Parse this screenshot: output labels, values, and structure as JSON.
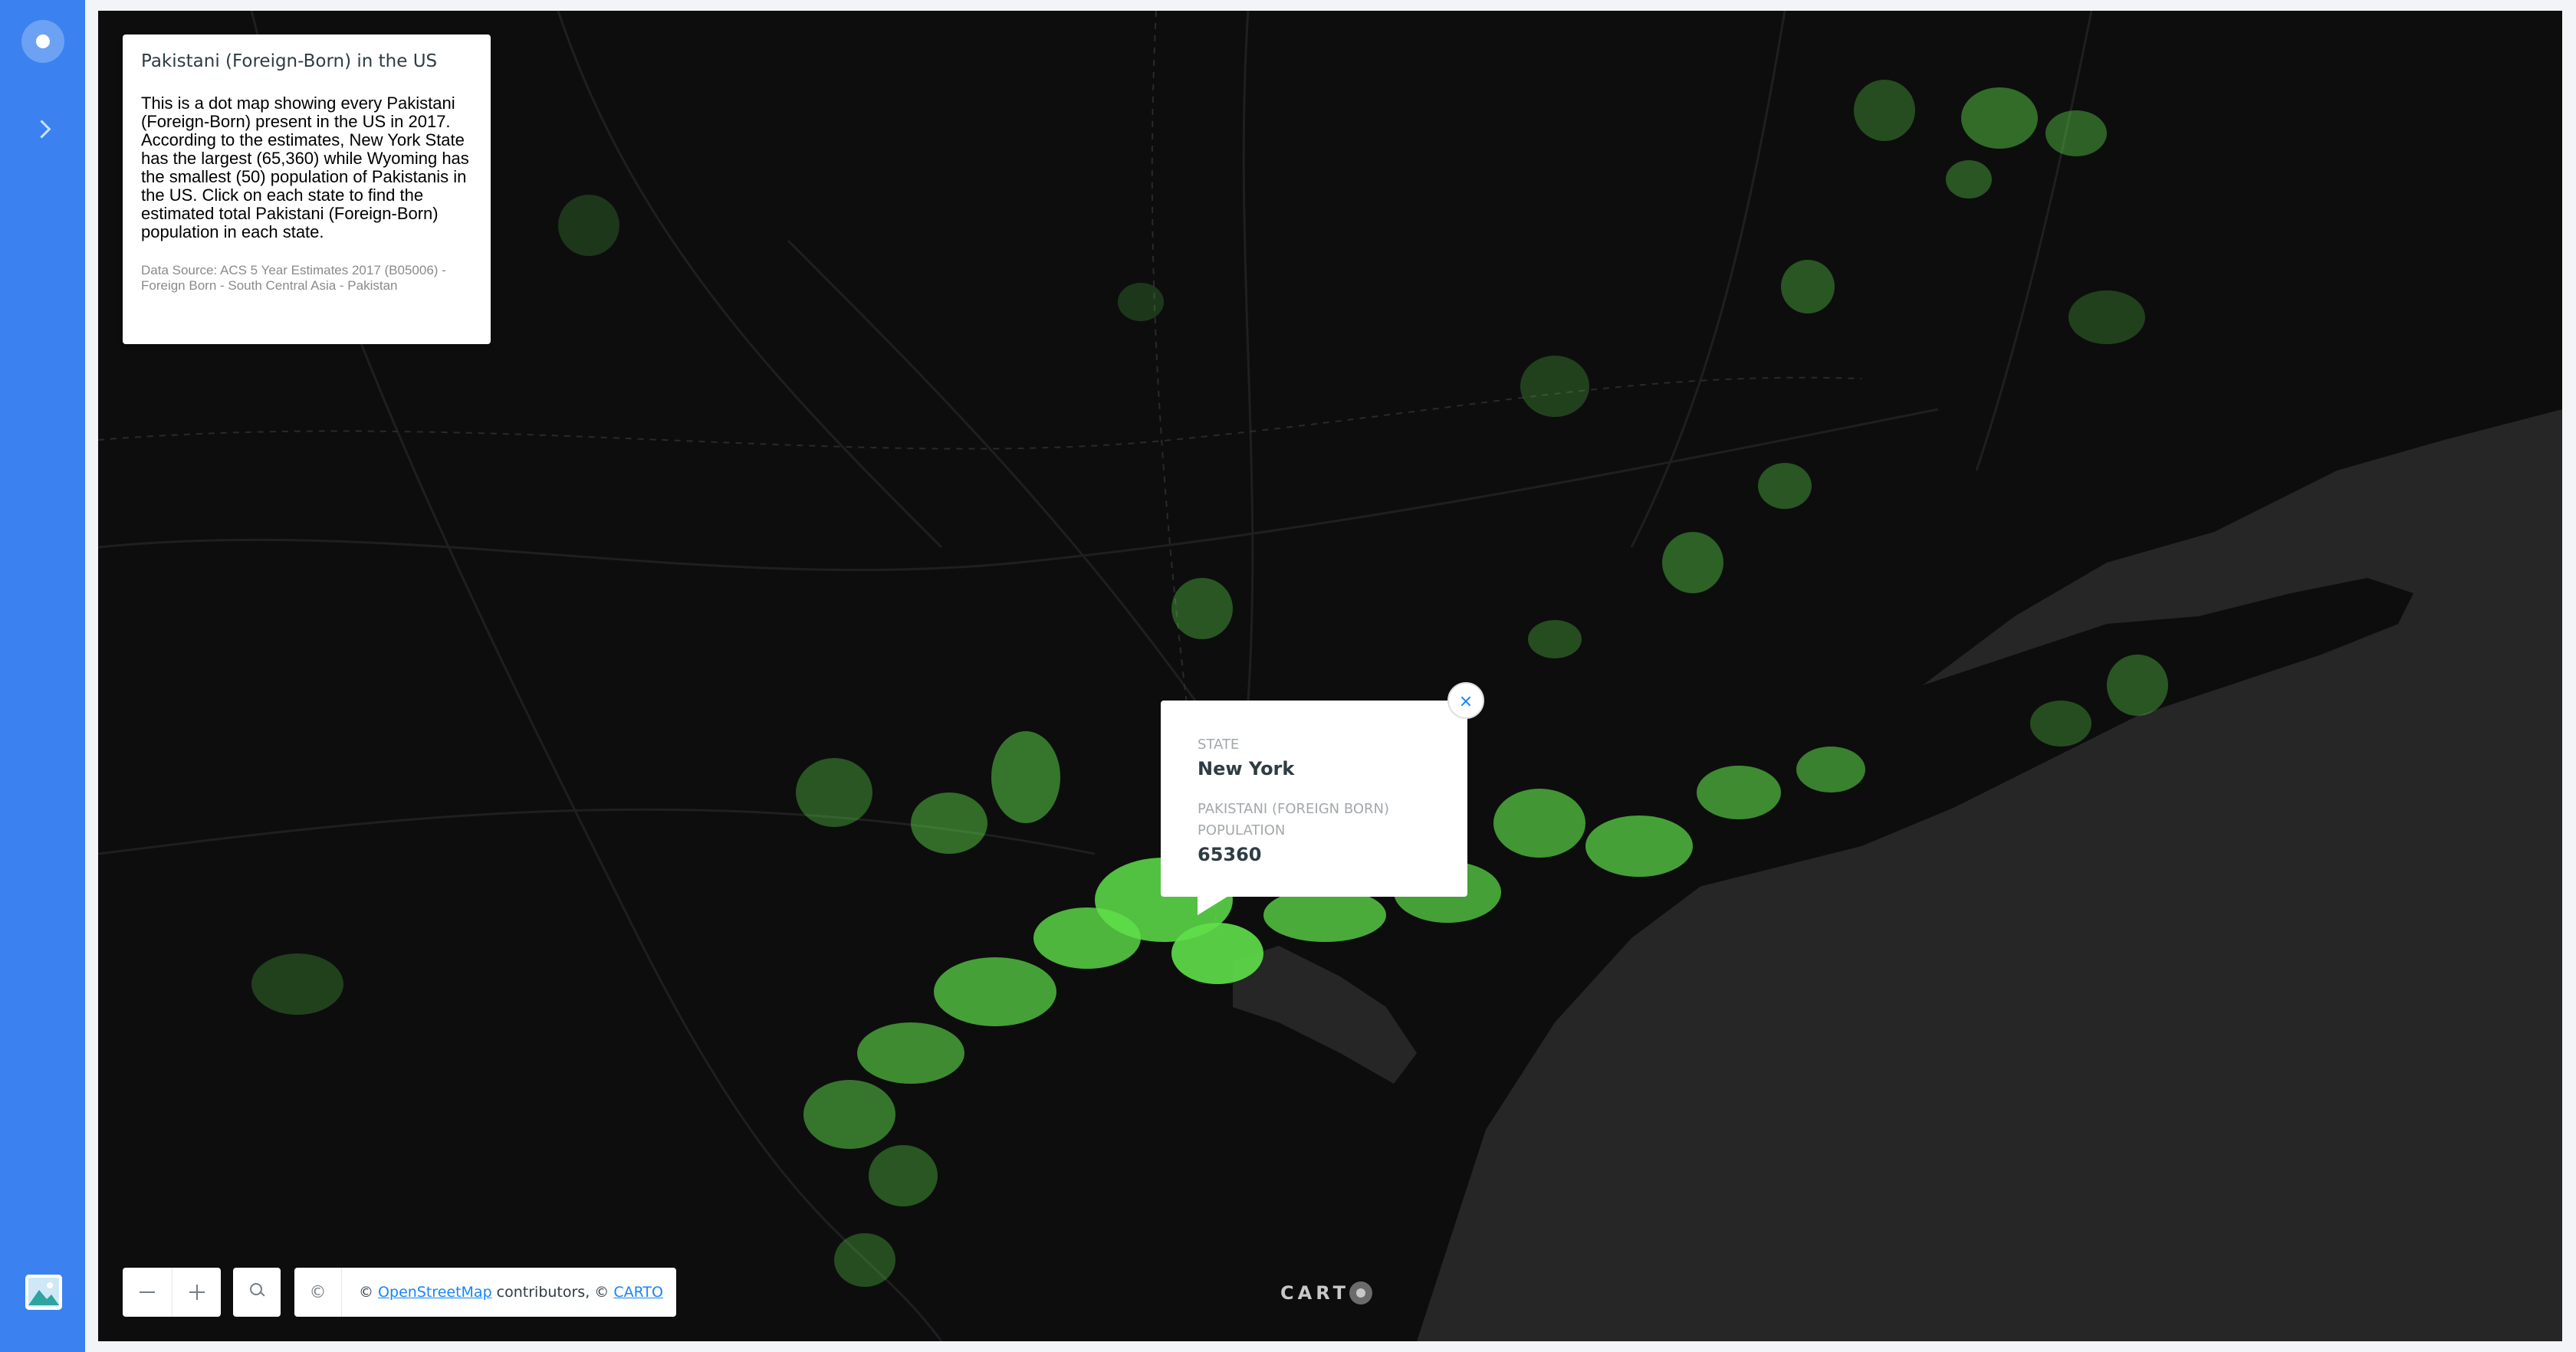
{
  "sidebar": {
    "home_icon": "circle-dot-icon",
    "expand_icon": "chevron-right-icon",
    "basemap_icon": "image-landscape-icon"
  },
  "info": {
    "title": "Pakistani (Foreign-Born) in the US",
    "description": "This is a dot map showing every Pakistani (Foreign-Born) present in the US in 2017. According to the estimates, New York State has the largest (65,360) while Wyoming has the smallest (50) population of Pakistanis in the US. Click on each state to find the estimated total Pakistani (Foreign-Born) population in each state.",
    "source": "Data Source: ACS 5 Year Estimates 2017 (B05006) - Foreign Born - South Central Asia - Pakistan"
  },
  "popup": {
    "state_label": "STATE",
    "state_value": "New York",
    "population_label": "PAKISTANI (FOREIGN BORN) POPULATION",
    "population_value": "65360"
  },
  "controls": {
    "zoom_out_icon": "minus-icon",
    "zoom_in_icon": "plus-icon",
    "search_icon": "search-icon",
    "attribution_icon": "copyright-icon",
    "attribution_symbol": "©",
    "attribution_prefix": "© ",
    "osm_link": "OpenStreetMap",
    "attribution_middle": " contributors, © ",
    "carto_link": "CARTO"
  },
  "logo": {
    "text": "CART"
  },
  "colors": {
    "sidebar": "#3b82f0",
    "map_background": "#0d0d0e",
    "water": "#262627",
    "dots": "#5fe04a",
    "accent": "#1785fb"
  }
}
